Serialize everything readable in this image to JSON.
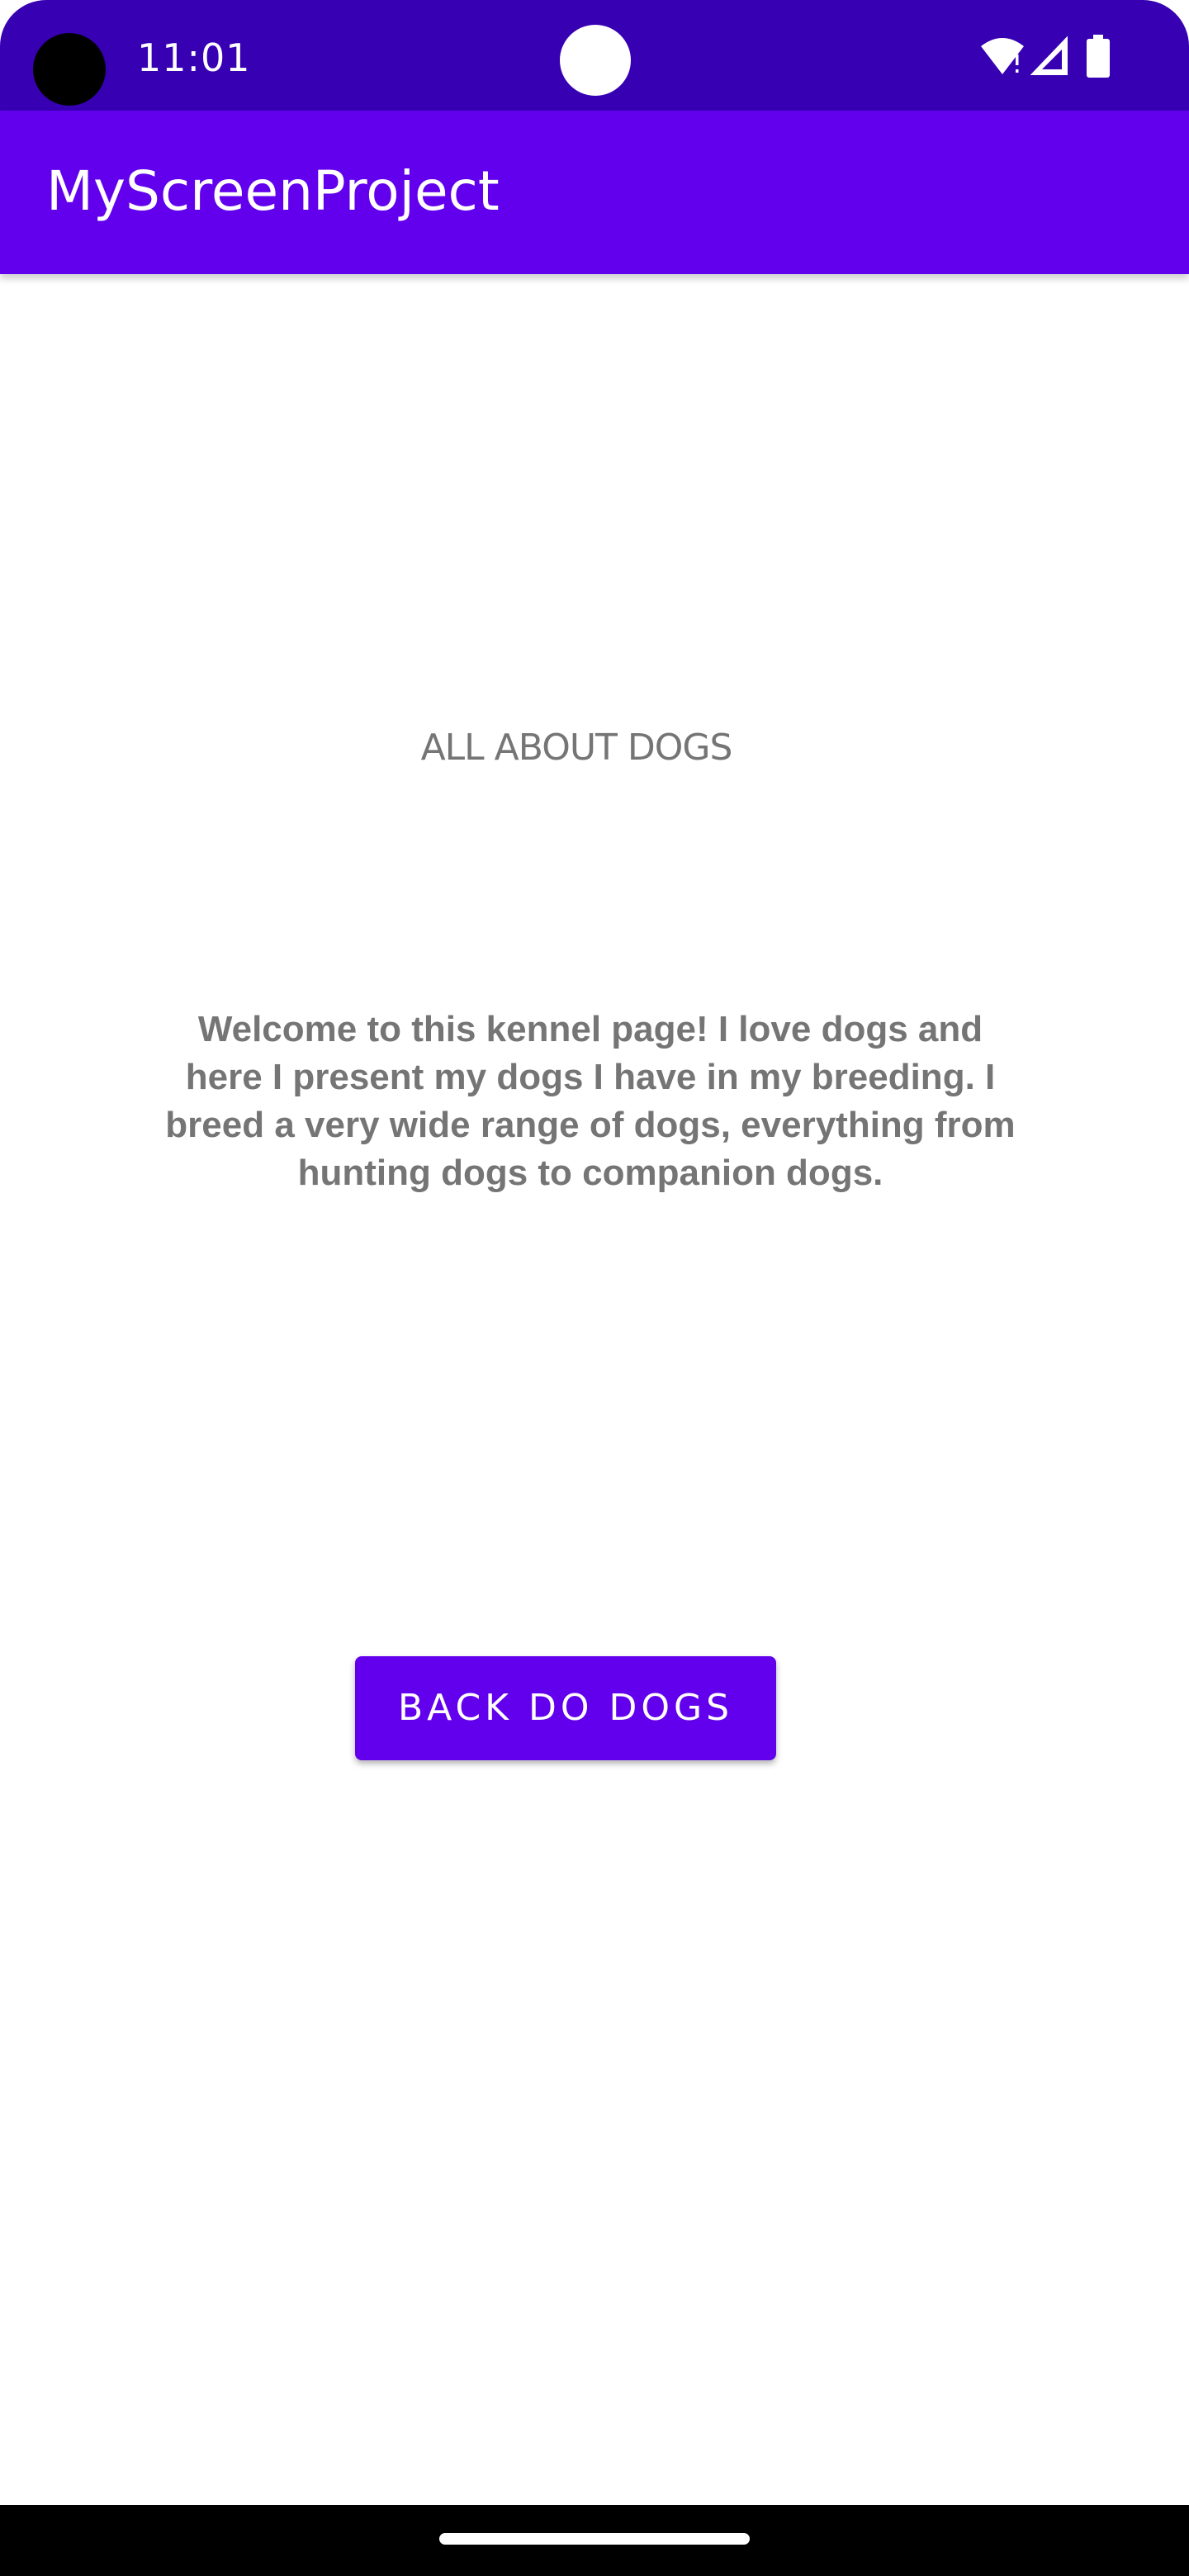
{
  "status_bar": {
    "time": "11:01",
    "icons": [
      "wifi-icon",
      "signal-icon",
      "battery-icon"
    ]
  },
  "app_bar": {
    "title": "MyScreenProject"
  },
  "content": {
    "heading": "ALL ABOUT DOGS",
    "description": "Welcome to this kennel page! I love dogs and here I present my dogs I have in my breeding. I breed a very wide range of dogs, everything from hunting dogs to companion dogs.",
    "back_button_label": "BACK DO DOGS"
  },
  "colors": {
    "status_bar": "#3700b3",
    "primary": "#6200ee",
    "text_secondary": "#757575"
  }
}
